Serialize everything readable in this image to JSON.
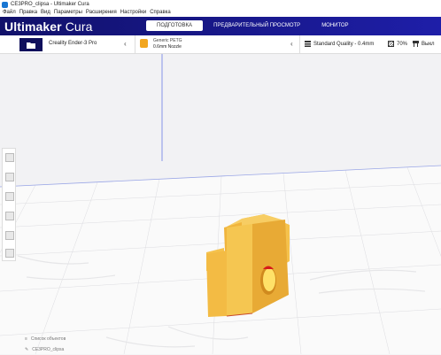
{
  "window": {
    "title": "CE3PRO_clipsa - Ultimaker Cura"
  },
  "menu": [
    "Файл",
    "Правка",
    "Вид",
    "Параметры",
    "Расширения",
    "Настройки",
    "Справка"
  ],
  "brand": {
    "bold": "Ultimaker",
    "light": "Cura"
  },
  "stages": [
    {
      "label": "ПОДГОТОВКА",
      "active": true
    },
    {
      "label": "ПРЕДВАРИТЕЛЬНЫЙ ПРОСМОТР",
      "active": false
    },
    {
      "label": "МОНИТОР",
      "active": false
    }
  ],
  "printer": {
    "name": "Creality Ender-3 Pro"
  },
  "material": {
    "name": "Generic PETG",
    "nozzle": "0.6mm Nozzle"
  },
  "print_settings": {
    "quality": "Standard Quality - 0.4mm",
    "infill": "70%",
    "support": "Выкл"
  },
  "object_list": {
    "header": "Список объектов",
    "file": "CE3PRO_clipsa"
  },
  "colors": {
    "header": "#1e1ea8",
    "model": "#f2b84b",
    "accent": "#f2a61f"
  },
  "icons": [
    "app-icon",
    "folder-icon",
    "chevron-left-icon",
    "quality-icon",
    "infill-icon",
    "support-icon",
    "move-tool-icon",
    "scale-tool-icon",
    "rotate-tool-icon",
    "mirror-tool-icon",
    "per-model-tool-icon",
    "support-blocker-icon",
    "list-icon",
    "edit-icon"
  ]
}
